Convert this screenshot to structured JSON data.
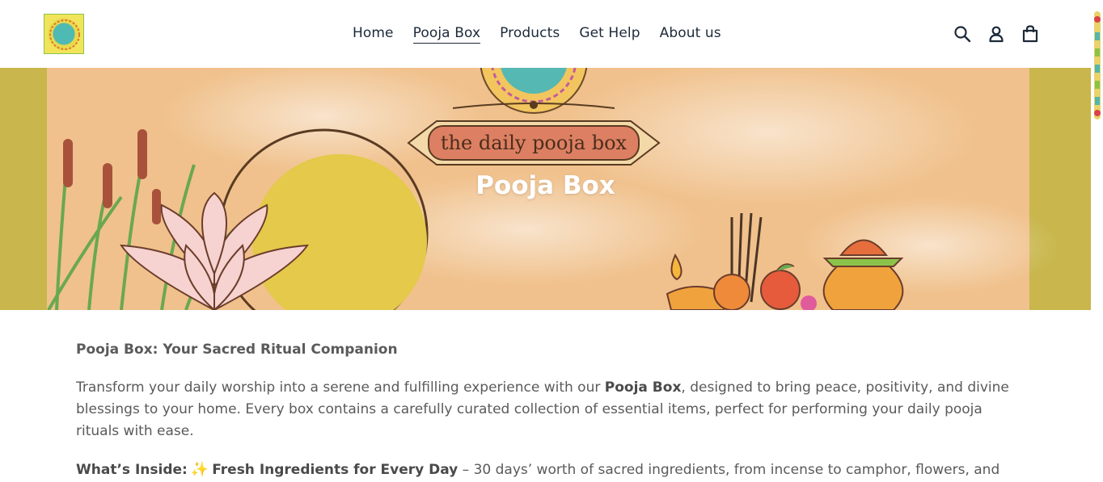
{
  "header": {
    "logo_alt": "pooja box",
    "nav": [
      {
        "label": "Home",
        "active": false
      },
      {
        "label": "Pooja Box",
        "active": true
      },
      {
        "label": "Products",
        "active": false
      },
      {
        "label": "Get Help",
        "active": false
      },
      {
        "label": "About us",
        "active": false
      }
    ],
    "icons": [
      "search-icon",
      "account-icon",
      "cart-icon"
    ]
  },
  "hero": {
    "banner_text": "the daily pooja box",
    "title": "Pooja Box"
  },
  "content": {
    "heading": "Pooja Box: Your Sacred Ritual Companion",
    "intro_before": "Transform your daily worship into a serene and fulfilling experience with our ",
    "intro_bold": "Pooja Box",
    "intro_after": ", designed to bring peace, positivity, and divine blessings to your home. Every box contains a carefully curated collection of essential items, perfect for performing your daily pooja rituals with ease.",
    "inside_label": "What’s Inside:",
    "inside_item_bold": "Fresh Ingredients for Every Day",
    "inside_item_text": " – 30 days’ worth of sacred ingredients, from incense to camphor, flowers, and"
  },
  "colors": {
    "nav_text": "#1c2a3a",
    "hero_bg": "#f0c18c",
    "hero_side": "#c9b64c",
    "body_text": "#5a5a5a"
  }
}
